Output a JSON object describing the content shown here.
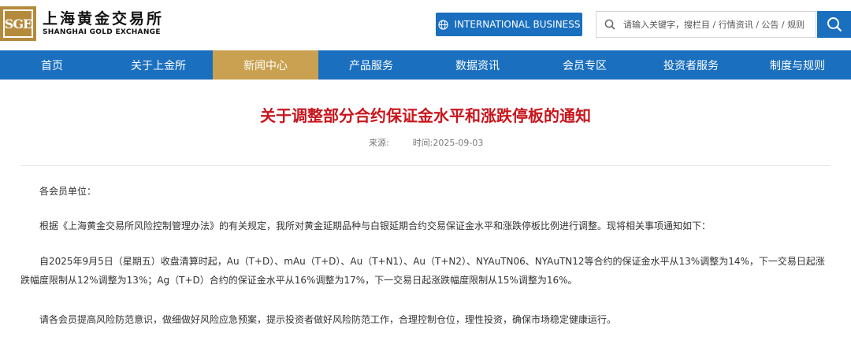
{
  "header": {
    "logo_mark": "SGE",
    "logo_cn": "上海黄金交易所",
    "logo_en": "SHANGHAI GOLD EXCHANGE",
    "intl_button": "INTERNATIONAL BUSINESS",
    "search_placeholder": "请输入关键字，搜栏目 / 行情资讯 / 公告 / 规则"
  },
  "nav": {
    "items": [
      {
        "label": "首页",
        "active": false
      },
      {
        "label": "关于上金所",
        "active": false
      },
      {
        "label": "新闻中心",
        "active": true
      },
      {
        "label": "产品服务",
        "active": false
      },
      {
        "label": "数据资讯",
        "active": false
      },
      {
        "label": "会员专区",
        "active": false
      },
      {
        "label": "投资者服务",
        "active": false
      },
      {
        "label": "制度与规则",
        "active": false
      }
    ]
  },
  "article": {
    "title": "关于调整部分合约保证金水平和涨跌停板的通知",
    "source_label": "来源:",
    "time_label": "时间:2025-09-03",
    "paragraphs": [
      "各会员单位：",
      "根据《上海黄金交易所风险控制管理办法》的有关规定，我所对黄金延期品种与白银延期合约交易保证金水平和涨跌停板比例进行调整。现将相关事项通知如下：",
      "自2025年9月5日（星期五）收盘清算时起，Au（T+D）、mAu（T+D）、Au（T+N1）、Au（T+N2）、NYAuTN06、NYAuTN12等合约的保证金水平从13%调整为14%，下一交易日起涨跌幅度限制从12%调整为13%；Ag（T+D）合约的保证金水平从16%调整为17%，下一交易日起涨跌幅度限制从15%调整为16%。",
      "请各会员提高风险防范意识，做细做好风险应急预案，提示投资者做好风险防范工作，合理控制仓位，理性投资，确保市场稳定健康运行。"
    ]
  },
  "colors": {
    "brand_blue": "#1a6fbf",
    "active_gold": "#c9a150",
    "title_red": "#c8161d",
    "logo_gold": "#b48a3c"
  },
  "icons": {
    "globe": "globe-icon",
    "search": "search-icon",
    "search_button": "search-icon"
  }
}
